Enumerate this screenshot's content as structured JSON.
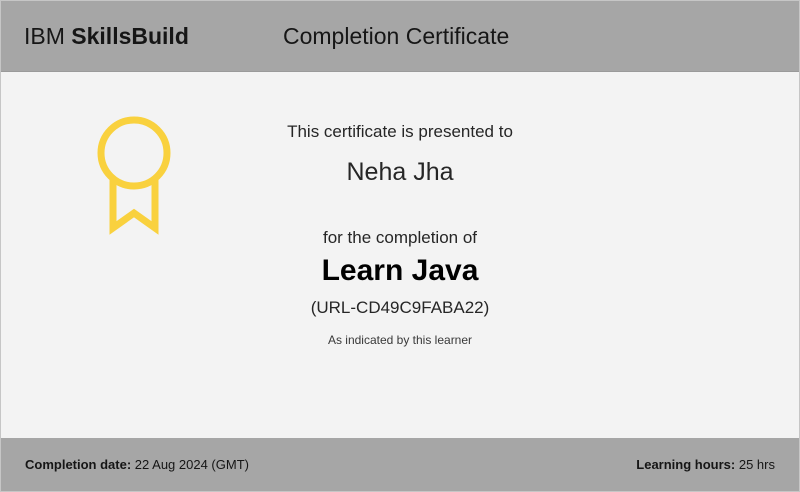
{
  "header": {
    "brand_light": "IBM",
    "brand_bold": "SkillsBuild",
    "title": "Completion Certificate"
  },
  "badge": {
    "icon": "award-ribbon-icon",
    "color": "#f9d13e"
  },
  "body": {
    "presented_to": "This certificate is presented to",
    "recipient": "Neha Jha",
    "for_completion": "for the completion of",
    "course": "Learn Java",
    "course_id": "(URL-CD49C9FABA22)",
    "note": "As indicated by this learner"
  },
  "footer": {
    "date_label": "Completion date:",
    "date_value": "22 Aug 2024 (GMT)",
    "hours_label": "Learning hours:",
    "hours_value": "25 hrs"
  },
  "colors": {
    "header_bg": "#a6a6a6",
    "body_bg": "#f3f3f3",
    "badge": "#f9d13e"
  }
}
